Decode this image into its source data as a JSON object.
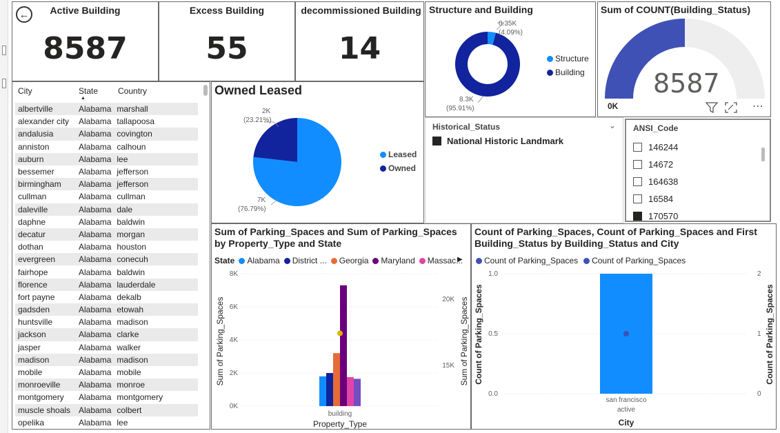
{
  "kpis": {
    "active": {
      "title": "Active Building",
      "value": "8587"
    },
    "excess": {
      "title": "Excess Building",
      "value": "55"
    },
    "decommissioned": {
      "title": "decommissioned Building",
      "value": "14"
    }
  },
  "structure_building": {
    "title": "Structure and Building",
    "label_structure": "0.35K",
    "label_structure_pct": "(4.09%)",
    "label_building": "8.3K",
    "label_building_pct": "(95.91%)",
    "legend": [
      "Structure",
      "Building"
    ],
    "colors": {
      "structure": "#118dff",
      "building": "#12239e"
    }
  },
  "gauge": {
    "title": "Sum of COUNT(Building_Status)",
    "value": "8587",
    "min_label": "0K",
    "fill_fraction": 0.5,
    "fill_color": "#3f51b5",
    "track_color": "#eeeeee"
  },
  "city_table": {
    "headers": {
      "city": "City",
      "state": "State",
      "country": "Country"
    },
    "rows": [
      [
        "albertville",
        "Alabama",
        "marshall"
      ],
      [
        "alexander city",
        "Alabama",
        "tallapoosa"
      ],
      [
        "andalusia",
        "Alabama",
        "covington"
      ],
      [
        "anniston",
        "Alabama",
        "calhoun"
      ],
      [
        "auburn",
        "Alabama",
        "lee"
      ],
      [
        "bessemer",
        "Alabama",
        "jefferson"
      ],
      [
        "birmingham",
        "Alabama",
        "jefferson"
      ],
      [
        "cullman",
        "Alabama",
        "cullman"
      ],
      [
        "daleville",
        "Alabama",
        "dale"
      ],
      [
        "daphne",
        "Alabama",
        "baldwin"
      ],
      [
        "decatur",
        "Alabama",
        "morgan"
      ],
      [
        "dothan",
        "Alabama",
        "houston"
      ],
      [
        "evergreen",
        "Alabama",
        "conecuh"
      ],
      [
        "fairhope",
        "Alabama",
        "baldwin"
      ],
      [
        "florence",
        "Alabama",
        "lauderdale"
      ],
      [
        "fort payne",
        "Alabama",
        "dekalb"
      ],
      [
        "gadsden",
        "Alabama",
        "etowah"
      ],
      [
        "huntsville",
        "Alabama",
        "madison"
      ],
      [
        "jackson",
        "Alabama",
        "clarke"
      ],
      [
        "jasper",
        "Alabama",
        "walker"
      ],
      [
        "madison",
        "Alabama",
        "madison"
      ],
      [
        "mobile",
        "Alabama",
        "mobile"
      ],
      [
        "monroeville",
        "Alabama",
        "monroe"
      ],
      [
        "montgomery",
        "Alabama",
        "montgomery"
      ],
      [
        "muscle shoals",
        "Alabama",
        "colbert"
      ],
      [
        "opelika",
        "Alabama",
        "lee"
      ]
    ]
  },
  "owned_leased": {
    "title": "Owned Leased",
    "label_owned": "2K",
    "label_owned_pct": "(23.21%)",
    "label_leased": "7K",
    "label_leased_pct": "(76.79%)",
    "legend": [
      "Leased",
      "Owned"
    ],
    "colors": {
      "leased": "#118dff",
      "owned": "#12239e"
    }
  },
  "historical": {
    "header": "Historical_Status",
    "item": "National Historic Landmark"
  },
  "ansi": {
    "header": "ANSI_Code",
    "items": [
      {
        "label": "146244",
        "checked": false
      },
      {
        "label": "14672",
        "checked": false
      },
      {
        "label": "164638",
        "checked": false
      },
      {
        "label": "16584",
        "checked": false
      },
      {
        "label": "170570",
        "checked": true
      }
    ]
  },
  "chart_data": [
    {
      "type": "bar",
      "title": "Sum of Parking_Spaces and Sum of Parking_Spaces by Property_Type and State",
      "legend_title": "State",
      "legend": [
        "Alabama",
        "District ...",
        "Georgia",
        "Maryland",
        "Massac..."
      ],
      "xlabel": "Property_Type",
      "ylabel": "Sum of Parking_Spaces",
      "y2label": "Sum of Parking_Spaces",
      "categories": [
        "building"
      ],
      "ylim": [
        0,
        8000
      ],
      "yticks": [
        "0K",
        "2K",
        "4K",
        "6K",
        "8K"
      ],
      "y2ticks": [
        "15K",
        "20K"
      ],
      "series": [
        {
          "name": "",
          "color": "#118dff",
          "values": [
            1800
          ]
        },
        {
          "name": "",
          "color": "#12239e",
          "values": [
            2000
          ]
        },
        {
          "name": "",
          "color": "#e66c37",
          "values": [
            3200
          ]
        },
        {
          "name": "",
          "color": "#6b007b",
          "values": [
            7300
          ]
        },
        {
          "name": "",
          "color": "#e044a7",
          "values": [
            1750
          ]
        },
        {
          "name": "",
          "color": "#744ec2",
          "values": [
            1650
          ]
        }
      ],
      "line_point": {
        "value": 4400,
        "color": "#d9b300"
      }
    },
    {
      "type": "bar",
      "title": "Count of Parking_Spaces, Count of Parking_Spaces and First Building_Status by Building_Status and City",
      "legend": [
        "Count of Parking_Spaces",
        "Count of Parking_Spaces"
      ],
      "legend_colors": [
        "#3f51b5",
        "#3f51b5"
      ],
      "xlabel": "City",
      "ylabel": "Count of Parking_Spaces",
      "y2label": "Count of Parking_Spaces",
      "categories": [
        "san francisco"
      ],
      "sub_categories": [
        "active"
      ],
      "ylim": [
        0,
        1
      ],
      "yticks": [
        "0.0",
        "0.5",
        "1.0"
      ],
      "y2ticks": [
        "0",
        "1",
        "2"
      ],
      "bar_value": 1.0,
      "bar_color": "#118dff",
      "point_value": 0.5,
      "point_color": "#3f51b5"
    }
  ]
}
